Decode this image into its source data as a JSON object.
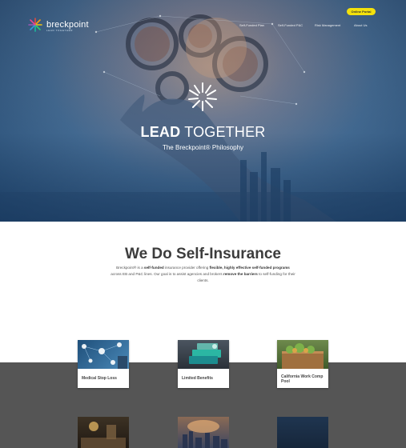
{
  "header": {
    "logo_name": "breckpoint",
    "logo_tagline": "LEAD TOGETHER",
    "nav": [
      {
        "label": "Self-Funded Plan"
      },
      {
        "label": "Self-Funded P&C"
      },
      {
        "label": "Risk Management"
      },
      {
        "label": "About Us"
      }
    ],
    "online_button": "Online Portal"
  },
  "hero": {
    "title_bold": "LEAD",
    "title_rest": " TOGETHER",
    "subtitle": "The Breckpoint® Philosophy"
  },
  "intro": {
    "title_bold": "We Do",
    "title_rest": " Self-Insurance",
    "p1": "Breckpoint® is a ",
    "p1_bold": "self-funded",
    "p2": " insurance provider offering ",
    "p2_bold": "flexible, highly effective self-funded programs",
    "p3": " across EB and P&C lines. Our goal is to assist agencies and brokers ",
    "p3_bold": "remove the barriers",
    "p4": " to self-funding for their clients."
  },
  "services": [
    {
      "label": "Medical Stop Loss",
      "icon": "medical-network-image"
    },
    {
      "label": "Limited Benefits",
      "icon": "cards-image"
    },
    {
      "label": "California Work Comp Pool",
      "icon": "produce-crate-image"
    }
  ],
  "colors": {
    "accent_yellow": "#f4e10b",
    "band_grey": "#555555",
    "hero_blue": "#2c5a85"
  }
}
